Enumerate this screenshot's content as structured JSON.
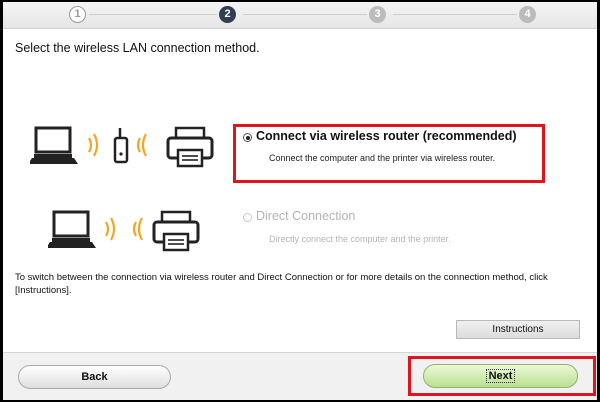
{
  "steps": [
    {
      "label": "1",
      "state": "done"
    },
    {
      "label": "2",
      "state": "active"
    },
    {
      "label": "3",
      "state": "pending"
    },
    {
      "label": "4",
      "state": "pending"
    }
  ],
  "heading": "Select the wireless LAN connection method.",
  "options": [
    {
      "title": "Connect via wireless router (recommended)",
      "description": "Connect the computer and the printer via wireless router.",
      "selected": true,
      "enabled": true
    },
    {
      "title": "Direct Connection",
      "description": "Directly connect the computer and the printer.",
      "selected": false,
      "enabled": false
    }
  ],
  "note": "To switch between the connection via wireless router and Direct Connection or for more details on the connection method, click [Instructions].",
  "buttons": {
    "instructions": "Instructions",
    "back": "Back",
    "next": "Next"
  },
  "colors": {
    "highlight": "#e0141e",
    "wifi": "#f5a623",
    "active_step": "#2f3e55",
    "next_button": "#b9e08f"
  },
  "icons": [
    "laptop-icon",
    "wifi-signal-icon",
    "router-icon",
    "printer-icon"
  ]
}
